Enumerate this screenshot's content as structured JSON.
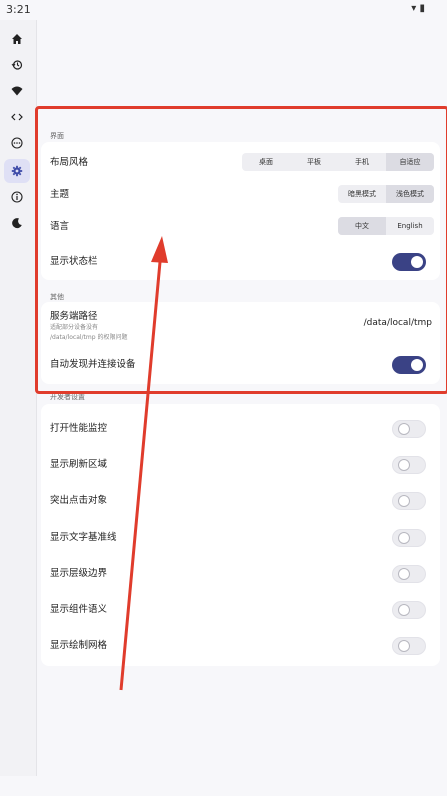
{
  "status_bar": {
    "time": "3:21",
    "icons": "▾ ▮"
  },
  "nav": {
    "items": [
      {
        "name": "home"
      },
      {
        "name": "history"
      },
      {
        "name": "wifi"
      },
      {
        "name": "code"
      },
      {
        "name": "more"
      },
      {
        "name": "settings"
      },
      {
        "name": "info"
      },
      {
        "name": "dark-mode"
      }
    ],
    "active_index": 5
  },
  "interface": {
    "section_title": "界面",
    "layout_style": {
      "label": "布局风格",
      "options": [
        "桌面",
        "平板",
        "手机",
        "自适应"
      ],
      "selected": "自适应"
    },
    "theme": {
      "label": "主题",
      "options": [
        "暗黑模式",
        "浅色模式"
      ],
      "selected": "浅色模式"
    },
    "language": {
      "label": "语言",
      "options": [
        "中文",
        "English"
      ],
      "selected": "中文"
    },
    "show_status_bar": {
      "label": "显示状态栏",
      "on": true
    }
  },
  "other": {
    "section_title": "其他",
    "server_path": {
      "label": "服务端路径",
      "hint1": "适配部分设备没有",
      "hint2": "/data/local/tmp 的权限问题",
      "value": "/data/local/tmp"
    },
    "auto_discover": {
      "label": "自动发现并连接设备",
      "on": true
    }
  },
  "developer": {
    "section_title": "开发者设置",
    "items": [
      {
        "label": "打开性能监控",
        "on": false
      },
      {
        "label": "显示刷新区域",
        "on": false
      },
      {
        "label": "突出点击对象",
        "on": false
      },
      {
        "label": "显示文字基准线",
        "on": false
      },
      {
        "label": "显示层级边界",
        "on": false
      },
      {
        "label": "显示组件语义",
        "on": false
      },
      {
        "label": "显示绘制网格",
        "on": false
      }
    ]
  },
  "colors": {
    "accent": "#3a4285",
    "annotation": "#e03c2c"
  }
}
